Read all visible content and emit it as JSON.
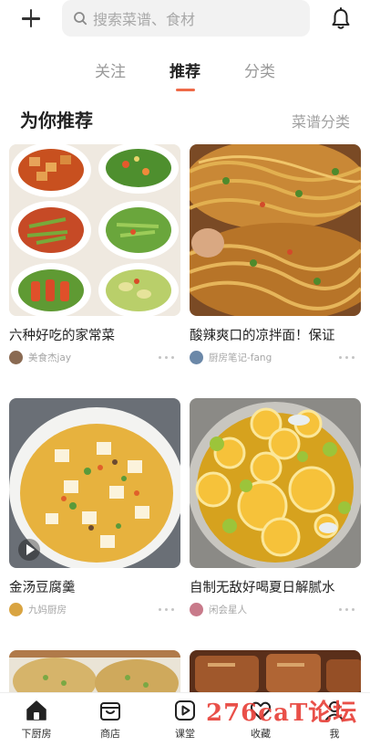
{
  "header": {
    "search_placeholder": "搜索菜谱、食材",
    "icons": {
      "add": "plus-icon",
      "search": "search-icon",
      "notifications": "bell-icon"
    }
  },
  "tabs": [
    {
      "label": "关注",
      "active": false
    },
    {
      "label": "推荐",
      "active": true
    },
    {
      "label": "分类",
      "active": false
    }
  ],
  "section": {
    "title": "为你推荐",
    "link": "菜谱分类"
  },
  "feed": [
    {
      "title": "六种好吃的家常菜",
      "author": "美食杰jay"
    },
    {
      "title": "酸辣爽口的凉拌面！保证",
      "author": "厨房笔记-fang"
    },
    {
      "title": "金汤豆腐羹",
      "author": "九妈厨房"
    },
    {
      "title": "自制无敌好喝夏日解腻水",
      "author": "闲会星人"
    }
  ],
  "bottom_nav": [
    {
      "label": "下厨房",
      "icon": "home-icon",
      "active": true
    },
    {
      "label": "商店",
      "icon": "shop-icon",
      "active": false
    },
    {
      "label": "课堂",
      "icon": "play-icon",
      "active": false
    },
    {
      "label": "收藏",
      "icon": "heart-icon",
      "active": false
    },
    {
      "label": "我",
      "icon": "profile-icon",
      "active": false
    }
  ],
  "watermark": "276caT论坛",
  "colors": {
    "accent": "#ee6a48",
    "watermark": "#e8423a"
  }
}
